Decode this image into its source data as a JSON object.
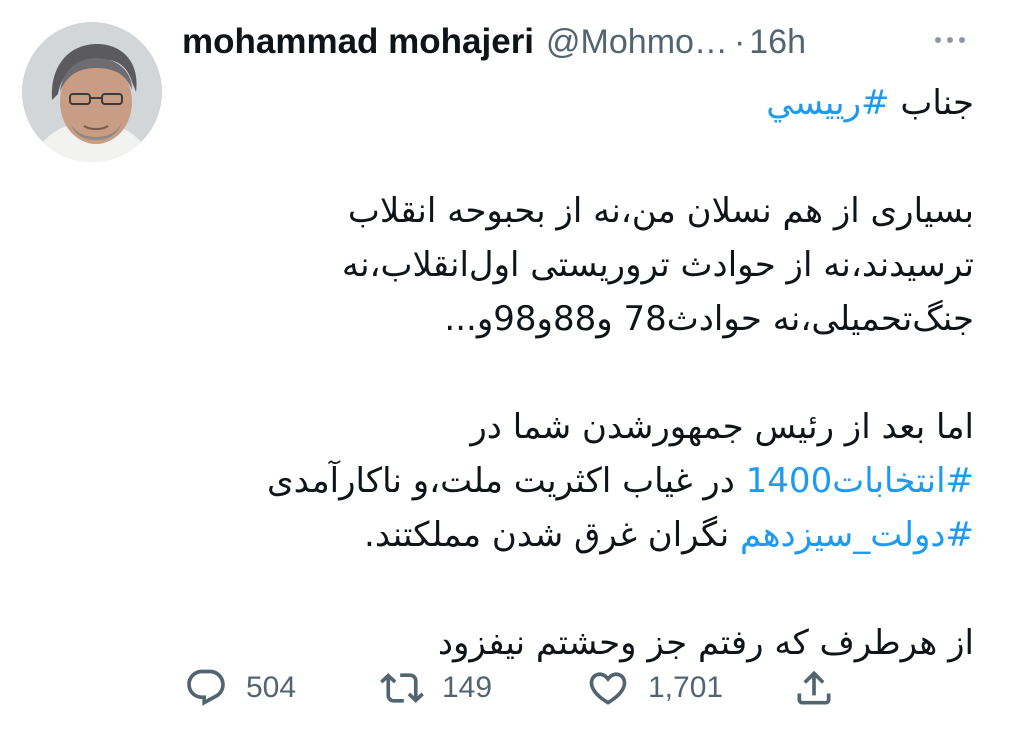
{
  "tweet": {
    "author_name": "mohammad mohajeri",
    "handle": "@Mohmo…",
    "separator": "·",
    "time": "16h",
    "more_icon": "more-dots-icon",
    "lines": [
      {
        "parts": [
          {
            "text": "جناب ",
            "tag": false
          },
          {
            "text": "#رييسي",
            "tag": true
          }
        ]
      },
      {
        "blank": true
      },
      {
        "parts": [
          {
            "text": "بسیاری از هم نسلان من،نه از بحبوحه انقلاب",
            "tag": false
          }
        ]
      },
      {
        "parts": [
          {
            "text": "ترسیدند،نه از حوادث تروریستی اول‌انقلاب،نه",
            "tag": false
          }
        ]
      },
      {
        "parts": [
          {
            "text": "جنگ‌تحمیلی،نه حوادث78 و88و98و...",
            "tag": false
          }
        ]
      },
      {
        "blank": true
      },
      {
        "parts": [
          {
            "text": "اما بعد از رئیس جمهورشدن شما در",
            "tag": false
          }
        ]
      },
      {
        "parts": [
          {
            "text": "#انتخابات1400",
            "tag": true
          },
          {
            "text": " در غیاب اکثریت ملت،و ناکارآمدی",
            "tag": false
          }
        ]
      },
      {
        "parts": [
          {
            "text": "#دولت_سیزدهم",
            "tag": true
          },
          {
            "text": " نگران غرق شدن مملکتند.",
            "tag": false
          }
        ]
      },
      {
        "blank": true
      },
      {
        "parts": [
          {
            "text": "از هرطرف که رفتم جز وحشتم نیفزود",
            "tag": false
          }
        ]
      }
    ]
  },
  "actions": {
    "reply": {
      "icon": "reply-icon",
      "count": "504"
    },
    "retweet": {
      "icon": "retweet-icon",
      "count": "149"
    },
    "like": {
      "icon": "heart-icon",
      "count": "1,701"
    },
    "share": {
      "icon": "share-icon"
    }
  },
  "colors": {
    "accent": "#1d9bf0",
    "text": "#0f1419",
    "muted": "#536471",
    "background": "#ffffff"
  }
}
